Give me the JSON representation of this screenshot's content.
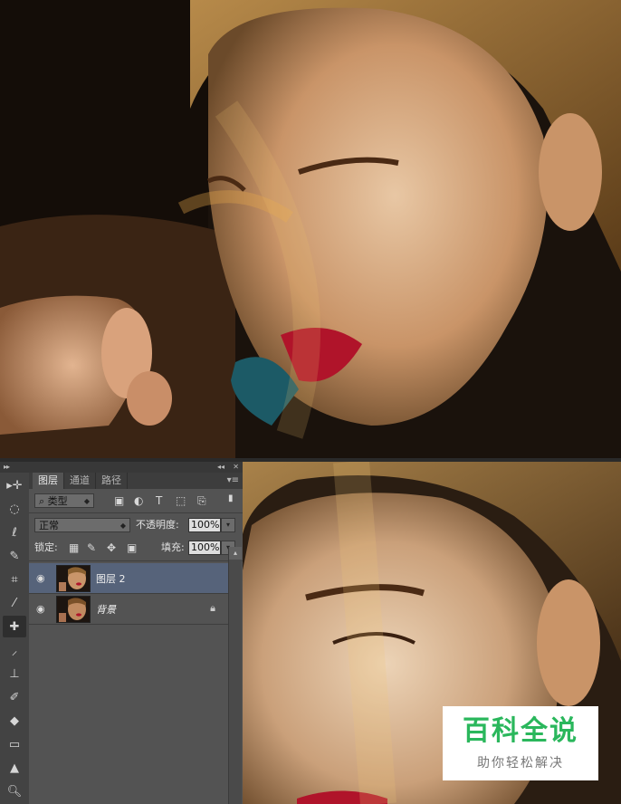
{
  "panel": {
    "collapse_glyph": "◂◂",
    "close_glyph": "✕",
    "tabs": [
      {
        "label": "图层"
      },
      {
        "label": "通道"
      },
      {
        "label": "路径"
      }
    ],
    "menu_glyph": "▾≡",
    "filter_label": "类型",
    "blend_mode": "正常",
    "opacity_label": "不透明度:",
    "opacity_value": "100%",
    "lock_label": "锁定:",
    "fill_label": "填充:",
    "fill_value": "100%",
    "layers": [
      {
        "name": "图层 2",
        "selected": true
      },
      {
        "name": "背景",
        "locked": true
      }
    ]
  },
  "toolbar": {
    "grip": "▸▸"
  },
  "watermark": {
    "title": "百科全说",
    "subtitle": "助你轻松解决"
  },
  "colors": {
    "panel_bg": "#535353",
    "toolbar_bg": "#434343",
    "selected_layer": "#56637a",
    "watermark_green": "#2ab75c"
  }
}
